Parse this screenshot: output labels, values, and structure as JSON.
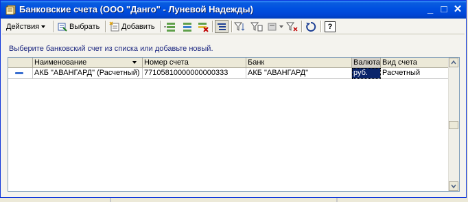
{
  "window": {
    "title": "Банковские счета (ООО \"Данго\" - Луневой Надежды)",
    "controls": {
      "minimize": "_",
      "maximize": "□",
      "close": "✕"
    }
  },
  "toolbar": {
    "actions_label": "Действия",
    "select_label": "Выбрать",
    "add_label": "Добавить",
    "help_label": "?"
  },
  "hint": "Выберите банковский счет из списка или добавьте новый.",
  "table": {
    "columns": [
      "Наименование",
      "Номер счета",
      "Банк",
      "Валюта",
      "Вид счета"
    ],
    "rows": [
      {
        "name": "АКБ \"АВАНГАРД\" (Расчетный)",
        "account": "77105810000000000333",
        "bank": "АКБ \"АВАНГАРД\"",
        "currency": "руб.",
        "type": "Расчетный"
      }
    ]
  },
  "colors": {
    "titlebar": "#0050e0",
    "selection": "#0a246a",
    "window_bg": "#f4f3ee"
  }
}
